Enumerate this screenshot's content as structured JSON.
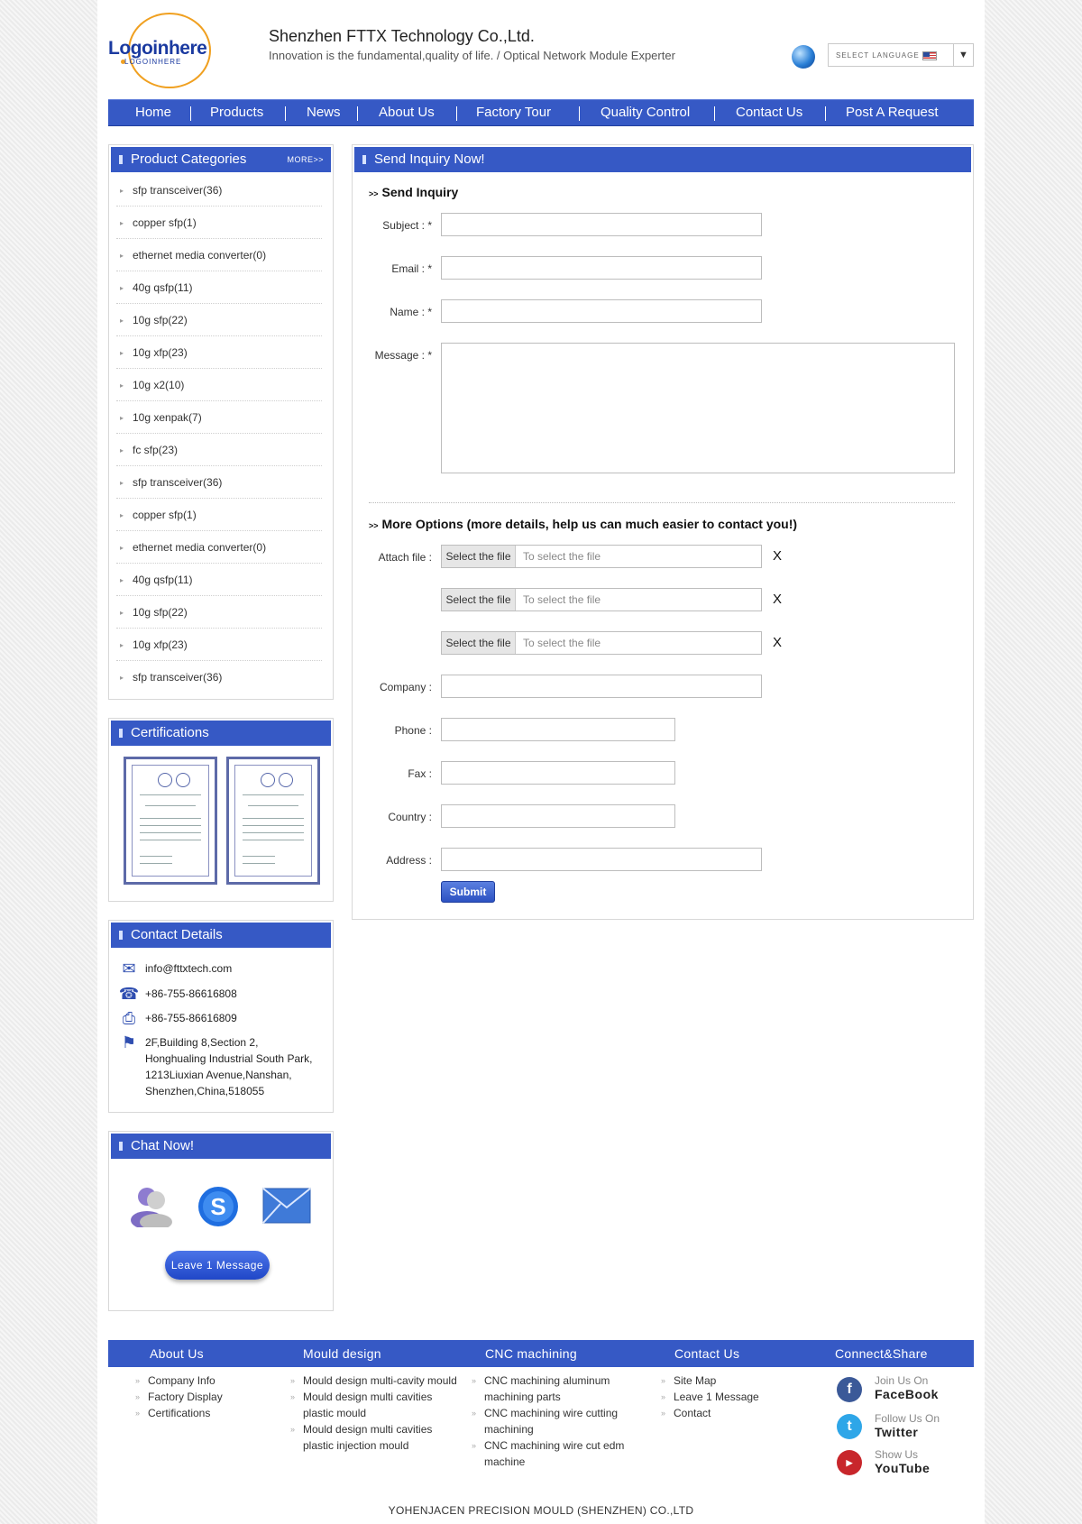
{
  "header": {
    "logo_text": "Logoinhere",
    "logo_sub": "LOGOINHERE",
    "company_name": "Shenzhen FTTX Technology Co.,Ltd.",
    "slogan": "Innovation is the fundamental,quality of life. / Optical Network Module Experter",
    "language_label": "SELECT LANGUAGE",
    "language_arrow": "▼"
  },
  "nav": {
    "items": [
      "Home",
      "Products",
      "News",
      "About Us",
      "Factory Tour",
      "Quality Control",
      "Contact Us",
      "Post A Request"
    ]
  },
  "product_categories": {
    "title": "Product Categories",
    "more": "MORE>>",
    "items": [
      "sfp transceiver(36)",
      "copper sfp(1)",
      "ethernet media converter(0)",
      "40g qsfp(11)",
      "10g sfp(22)",
      "10g xfp(23)",
      "10g x2(10)",
      "10g xenpak(7)",
      "fc sfp(23)",
      "sfp transceiver(36)",
      "copper sfp(1)",
      "ethernet media converter(0)",
      "40g qsfp(11)",
      "10g sfp(22)",
      "10g xfp(23)",
      "sfp transceiver(36)"
    ]
  },
  "certifications": {
    "title": "Certifications"
  },
  "contact_details": {
    "title": "Contact Details",
    "email": "info@fttxtech.com",
    "phone": "+86-755-86616808",
    "fax": "+86-755-86616809",
    "address_lines": [
      "2F,Building 8,Section 2,",
      "Honghualing Industrial South Park,",
      "1213Liuxian Avenue,Nanshan,",
      "Shenzhen,China,518055"
    ]
  },
  "chat": {
    "title": "Chat Now!",
    "leave_message": "Leave 1 Message"
  },
  "inquiry": {
    "panel_title": "Send Inquiry Now!",
    "section1": "Send Inquiry",
    "subject_label": "Subject : *",
    "email_label": "Email : *",
    "name_label": "Name : *",
    "message_label": "Message : *",
    "section2": "More Options (more details, help us can much easier to contact you!)",
    "attach_label": "Attach file :",
    "select_file": "Select the file",
    "file_placeholder": "To select the file",
    "remove": "X",
    "company_label": "Company :",
    "phone_label": "Phone :",
    "fax_label": "Fax :",
    "country_label": "Country :",
    "address_label": "Address :",
    "submit": "Submit"
  },
  "footer": {
    "about": {
      "title": "About Us",
      "links": [
        "Company Info",
        "Factory Display",
        "Certifications"
      ]
    },
    "mould": {
      "title": "Mould design",
      "links": [
        "Mould design multi-cavity mould",
        "Mould design multi cavities",
        "plastic mould",
        "Mould design multi cavities",
        "plastic injection mould"
      ]
    },
    "cnc": {
      "title": "CNC machining",
      "links": [
        "CNC machining aluminum",
        "machining parts",
        "CNC machining wire cutting",
        "machining",
        "CNC machining wire cut edm",
        "machine"
      ]
    },
    "contact": {
      "title": "Contact Us",
      "links": [
        "Site Map",
        "Leave 1 Message",
        "Contact"
      ]
    },
    "share": {
      "title": "Connect&Share",
      "facebook_top": "Join Us On",
      "facebook": "FaceBook",
      "twitter_top": "Follow Us On",
      "twitter": "Twitter",
      "youtube_top": "Show Us",
      "youtube": "YouTube"
    },
    "copyright": "YOHENJACEN PRECISION MOULD (SHENZHEN) CO.,LTD"
  },
  "colors": {
    "brand": "#3659c5",
    "accent": "#f0a020"
  }
}
